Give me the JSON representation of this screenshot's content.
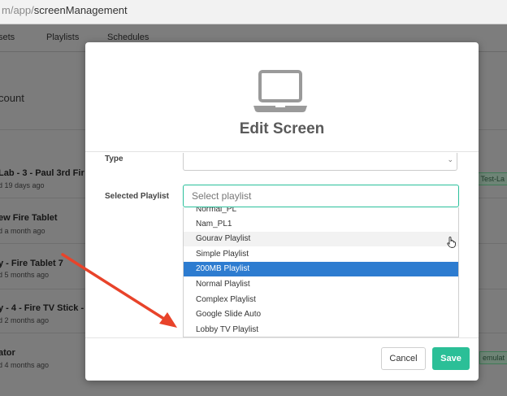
{
  "browser": {
    "url_dim": "m/app/",
    "url_main": "screenManagement"
  },
  "nav": {
    "items": [
      "sets",
      "Playlists",
      "Schedules"
    ]
  },
  "background": {
    "heading": "count",
    "rows": [
      {
        "name": "Lab - 3 - Paul 3rd Fir",
        "sub": "d 19 days ago",
        "tag": "Test-La"
      },
      {
        "name": "ew Fire Tablet",
        "sub": "d a month ago",
        "tag": ""
      },
      {
        "name": "y - Fire Tablet 7",
        "sub": "d 5 months ago",
        "tag": ""
      },
      {
        "name": "y - 4 - Fire TV Stick -",
        "sub": "d 2 months ago",
        "tag": ""
      },
      {
        "name": "ator",
        "sub": "d 4 months ago",
        "tag": "emulat"
      }
    ]
  },
  "modal": {
    "title": "Edit Screen",
    "icon": "laptop-icon",
    "type_label": "Type",
    "selected_playlist_label": "Selected Playlist",
    "playlist_input": {
      "value": "",
      "placeholder": "Select playlist"
    },
    "options": [
      {
        "label": "Normal_PL",
        "state": "normal"
      },
      {
        "label": "Nam_PL1",
        "state": "normal"
      },
      {
        "label": "Gourav Playlist",
        "state": "hover"
      },
      {
        "label": "Simple Playlist",
        "state": "normal"
      },
      {
        "label": "200MB Playlist",
        "state": "selected"
      },
      {
        "label": "Normal Playlist",
        "state": "normal"
      },
      {
        "label": "Complex Playlist",
        "state": "normal"
      },
      {
        "label": "Google Slide Auto",
        "state": "normal"
      },
      {
        "label": "Lobby TV Playlist",
        "state": "normal"
      }
    ],
    "cancel_label": "Cancel",
    "save_label": "Save"
  },
  "colors": {
    "accent": "#2bbf97",
    "selected_option": "#2d7cd0",
    "annotation_arrow": "#e8432a"
  }
}
